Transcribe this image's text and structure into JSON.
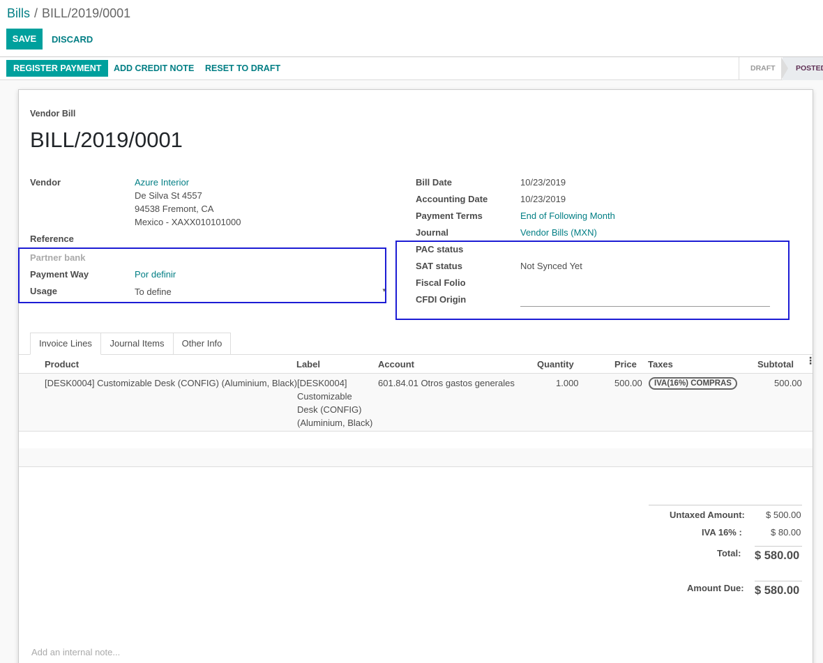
{
  "breadcrumb": {
    "parent": "Bills",
    "separator": "/",
    "current": "BILL/2019/0001"
  },
  "toolbar": {
    "save_label": "SAVE",
    "discard_label": "DISCARD"
  },
  "actions": {
    "register_payment": "REGISTER PAYMENT",
    "add_credit_note": "ADD CREDIT NOTE",
    "reset_to_draft": "RESET TO DRAFT"
  },
  "status": {
    "draft": "DRAFT",
    "posted": "POSTED",
    "current": "POSTED"
  },
  "document": {
    "type": "Vendor Bill",
    "number": "BILL/2019/0001"
  },
  "left_fields": {
    "vendor_label": "Vendor",
    "vendor_name": "Azure Interior",
    "vendor_address": [
      "De Silva St 4557",
      "94538 Fremont, CA",
      "Mexico - XAXX010101000"
    ],
    "reference_label": "Reference",
    "partner_bank_label": "Partner bank",
    "payment_way_label": "Payment Way",
    "payment_way_value": "Por definir",
    "usage_label": "Usage",
    "usage_value": "To define"
  },
  "right_fields": {
    "bill_date_label": "Bill Date",
    "bill_date_value": "10/23/2019",
    "accounting_date_label": "Accounting Date",
    "accounting_date_value": "10/23/2019",
    "payment_terms_label": "Payment Terms",
    "payment_terms_value": "End of Following Month",
    "journal_label": "Journal",
    "journal_value": "Vendor Bills (MXN)",
    "pac_status_label": "PAC status",
    "sat_status_label": "SAT status",
    "sat_status_value": "Not Synced Yet",
    "fiscal_folio_label": "Fiscal Folio",
    "cfdi_origin_label": "CFDI Origin"
  },
  "tabs": [
    {
      "label": "Invoice Lines",
      "active": true
    },
    {
      "label": "Journal Items",
      "active": false
    },
    {
      "label": "Other Info",
      "active": false
    }
  ],
  "table": {
    "columns": [
      "Product",
      "Label",
      "Account",
      "Quantity",
      "Price",
      "Taxes",
      "Subtotal"
    ],
    "rows": [
      {
        "product": "[DESK0004] Customizable Desk (CONFIG) (Aluminium, Black)",
        "label_lines": [
          "[DESK0004]",
          "Customizable",
          "Desk (CONFIG)",
          "(Aluminium, Black)"
        ],
        "account": "601.84.01 Otros gastos generales",
        "quantity": "1.000",
        "price": "500.00",
        "tax": "IVA(16%) COMPRAS",
        "subtotal": "500.00"
      }
    ]
  },
  "totals": {
    "untaxed_label": "Untaxed Amount:",
    "untaxed_value": "$ 500.00",
    "iva_label": "IVA 16% :",
    "iva_value": "$ 80.00",
    "total_label": "Total:",
    "total_value": "$ 580.00",
    "amount_due_label": "Amount Due:",
    "amount_due_value": "$ 580.00"
  },
  "note_placeholder": "Add an internal note...",
  "colors": {
    "primary": "#00a09d",
    "link": "#017e84",
    "highlight_box": "#1c1cd4",
    "posted": "#5f2f54"
  },
  "icons": {
    "column_options": "vertical-dots-icon",
    "dropdown": "caret-down-icon"
  }
}
